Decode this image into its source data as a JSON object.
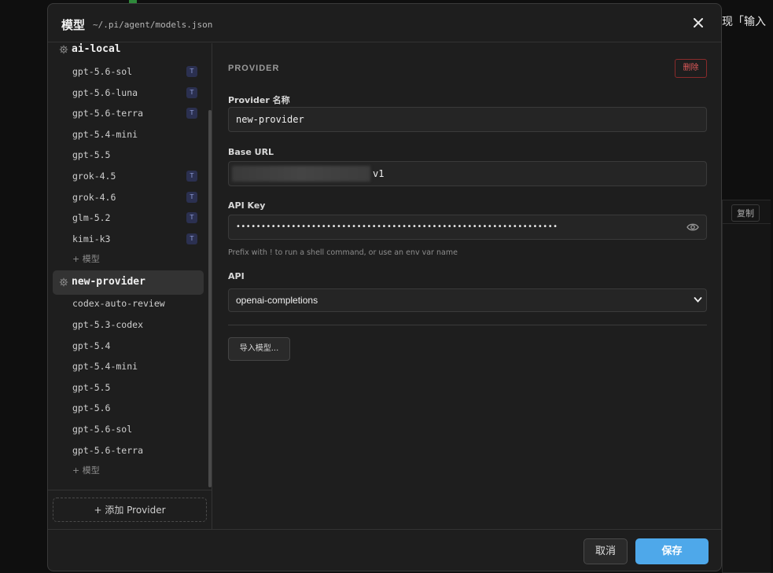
{
  "background": {
    "right_text": "现「输入",
    "copy_label": "复制"
  },
  "modal": {
    "title": "模型",
    "path": "~/.pi/agent/models.json"
  },
  "sidebar": {
    "providers": [
      {
        "name": "ai-local",
        "active": false,
        "models": [
          {
            "name": "gpt-5.6-sol",
            "badge": "T"
          },
          {
            "name": "gpt-5.6-luna",
            "badge": "T"
          },
          {
            "name": "gpt-5.6-terra",
            "badge": "T"
          },
          {
            "name": "gpt-5.4-mini",
            "badge": ""
          },
          {
            "name": "gpt-5.5",
            "badge": ""
          },
          {
            "name": "grok-4.5",
            "badge": "T"
          },
          {
            "name": "grok-4.6",
            "badge": "T"
          },
          {
            "name": "glm-5.2",
            "badge": "T"
          },
          {
            "name": "kimi-k3",
            "badge": "T"
          }
        ],
        "add_model_label": "+ 模型"
      },
      {
        "name": "new-provider",
        "active": true,
        "models": [
          {
            "name": "codex-auto-review",
            "badge": ""
          },
          {
            "name": "gpt-5.3-codex",
            "badge": ""
          },
          {
            "name": "gpt-5.4",
            "badge": ""
          },
          {
            "name": "gpt-5.4-mini",
            "badge": ""
          },
          {
            "name": "gpt-5.5",
            "badge": ""
          },
          {
            "name": "gpt-5.6",
            "badge": ""
          },
          {
            "name": "gpt-5.6-sol",
            "badge": ""
          },
          {
            "name": "gpt-5.6-terra",
            "badge": ""
          }
        ],
        "add_model_label": "+ 模型"
      }
    ],
    "add_provider_label": "+ 添加 Provider"
  },
  "form": {
    "section_title": "PROVIDER",
    "delete_label": "删除",
    "name_label": "Provider 名称",
    "name_value": "new-provider",
    "base_url_label": "Base URL",
    "base_url_tail": "v1",
    "api_key_label": "API Key",
    "api_key_masked": "••••••••••••••••••••••••••••••••••••••••••••••••••••••••••••••••",
    "api_key_hint": "Prefix with ! to run a shell command, or use an env var name",
    "api_label": "API",
    "api_value": "openai-completions",
    "import_label": "导入模型..."
  },
  "footer": {
    "cancel_label": "取消",
    "save_label": "保存"
  },
  "colors": {
    "accent": "#4ea8ea",
    "danger": "#e05a5a",
    "badge_bg": "#2b3050"
  }
}
